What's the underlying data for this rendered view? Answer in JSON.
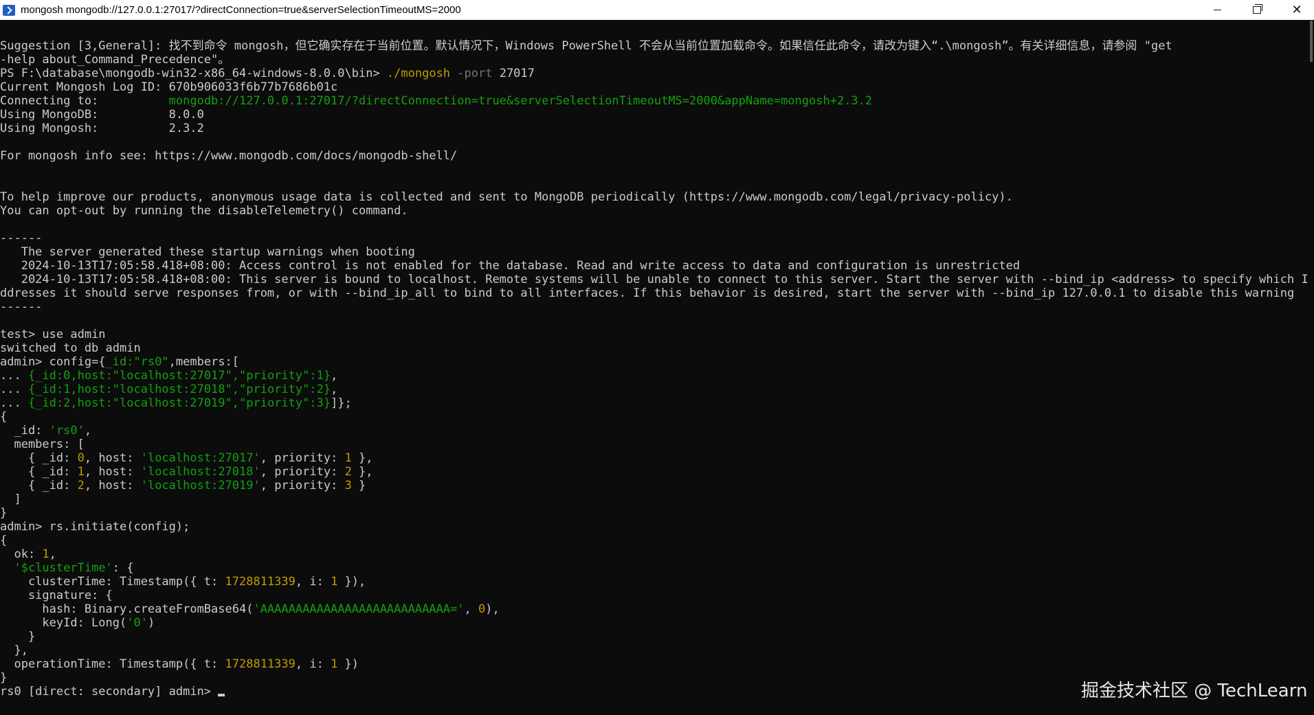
{
  "window": {
    "title": "mongosh mongodb://127.0.0.1:27017/?directConnection=true&serverSelectionTimeoutMS=2000",
    "icon": "powershell-icon",
    "controls": {
      "minimize": "minimize-icon",
      "maximize": "restore-icon",
      "close": "✕"
    }
  },
  "colors": {
    "background": "#0c0c0c",
    "text": "#cccccc",
    "green": "#13a10e",
    "yellow": "#c19c00"
  },
  "terminal": {
    "suggestion_line1": "Suggestion [3,General]: 找不到命令 mongosh，但它确实存在于当前位置。默认情况下，Windows PowerShell 不会从当前位置加载命令。如果信任此命令，请改为键入“.\\mongosh”。有关详细信息，请参阅 \"get",
    "suggestion_line2": "-help about_Command_Precedence\"。",
    "ps_prompt": "PS F:\\database\\mongodb-win32-x86_64-windows-8.0.0\\bin> ",
    "ps_cmd": "./mongosh",
    "ps_flag": " -port ",
    "ps_port": "27017",
    "log_id": "Current Mongosh Log ID: 670b906033f6b77b7686b01c",
    "connecting_label": "Connecting to:          ",
    "connecting_url": "mongodb://127.0.0.1:27017/?directConnection=true&serverSelectionTimeoutMS=2000&appName=mongosh+2.3.2",
    "using_mongodb_label": "Using MongoDB:          ",
    "using_mongodb_value": "8.0.0",
    "using_mongosh_label": "Using Mongosh:          ",
    "using_mongosh_value": "2.3.2",
    "info_line": "For mongosh info see: https://www.mongodb.com/docs/mongodb-shell/",
    "telemetry_line1": "To help improve our products, anonymous usage data is collected and sent to MongoDB periodically (https://www.mongodb.com/legal/privacy-policy).",
    "telemetry_line2": "You can opt-out by running the disableTelemetry() command.",
    "separator": "------",
    "warn_header": "   The server generated these startup warnings when booting",
    "warn1": "   2024-10-13T17:05:58.418+08:00: Access control is not enabled for the database. Read and write access to data and configuration is unrestricted",
    "warn2a": "   2024-10-13T17:05:58.418+08:00: This server is bound to localhost. Remote systems will be unable to connect to this server. Start the server with --bind_ip <address> to specify which IP a",
    "warn2b": "ddresses it should serve responses from, or with --bind_ip_all to bind to all interfaces. If this behavior is desired, start the server with --bind_ip 127.0.0.1 to disable this warning",
    "use_prompt": "test> ",
    "use_cmd": "use admin",
    "switched": "switched to db admin",
    "config_prompt": "admin> ",
    "config_pre": "config={",
    "config_id": "_id:\"rs0\"",
    "config_post": ",members:[",
    "cont": "... ",
    "m0_a": "{_id:0,host:\"localhost:27017\",\"priority\":1}",
    "m0_b": ",",
    "m1_a": "{_id:1,host:\"localhost:27018\",\"priority\":2}",
    "m1_b": ",",
    "m2_a": "{_id:2,host:\"localhost:27019\",\"priority\":3}",
    "m2_b": "]};",
    "out_open": "{",
    "out_id_key": "  _id: ",
    "out_id_val": "'rs0'",
    "out_id_comma": ",",
    "out_members": "  members: [",
    "r0_a": "    { _id: ",
    "r0_id": "0",
    "r0_b": ", host: ",
    "r0_host": "'localhost:27017'",
    "r0_c": ", priority: ",
    "r0_pri": "1",
    "r0_d": " },",
    "r1_a": "    { _id: ",
    "r1_id": "1",
    "r1_b": ", host: ",
    "r1_host": "'localhost:27018'",
    "r1_c": ", priority: ",
    "r1_pri": "2",
    "r1_d": " },",
    "r2_a": "    { _id: ",
    "r2_id": "2",
    "r2_b": ", host: ",
    "r2_host": "'localhost:27019'",
    "r2_c": ", priority: ",
    "r2_pri": "3",
    "r2_d": " }",
    "out_members_close": "  ]",
    "out_close": "}",
    "initiate_prompt": "admin> ",
    "initiate_cmd": "rs.initiate(config);",
    "res_open": "{",
    "res_ok_key": "  ok: ",
    "res_ok_val": "1",
    "res_ok_comma": ",",
    "res_ct_pre": "  ",
    "res_ct_key": "'$clusterTime'",
    "res_ct_post": ": {",
    "res_ctime_a": "    clusterTime: Timestamp({ t: ",
    "res_ctime_t": "1728811339",
    "res_ctime_b": ", i: ",
    "res_ctime_i": "1",
    "res_ctime_c": " }),",
    "res_sig": "    signature: {",
    "res_hash_a": "      hash: Binary.createFromBase64(",
    "res_hash_val": "'AAAAAAAAAAAAAAAAAAAAAAAAAAA='",
    "res_hash_b": ", ",
    "res_hash_zero": "0",
    "res_hash_c": "),",
    "res_keyid_a": "      keyId: Long(",
    "res_keyid_val": "'0'",
    "res_keyid_b": ")",
    "res_sig_close": "    }",
    "res_ct_close": "  },",
    "res_op_a": "  operationTime: Timestamp({ t: ",
    "res_op_t": "1728811339",
    "res_op_b": ", i: ",
    "res_op_i": "1",
    "res_op_c": " })",
    "res_close": "}",
    "final_prompt": "rs0 [direct: secondary] admin> "
  },
  "watermark": "掘金技术社区 @ TechLearn"
}
